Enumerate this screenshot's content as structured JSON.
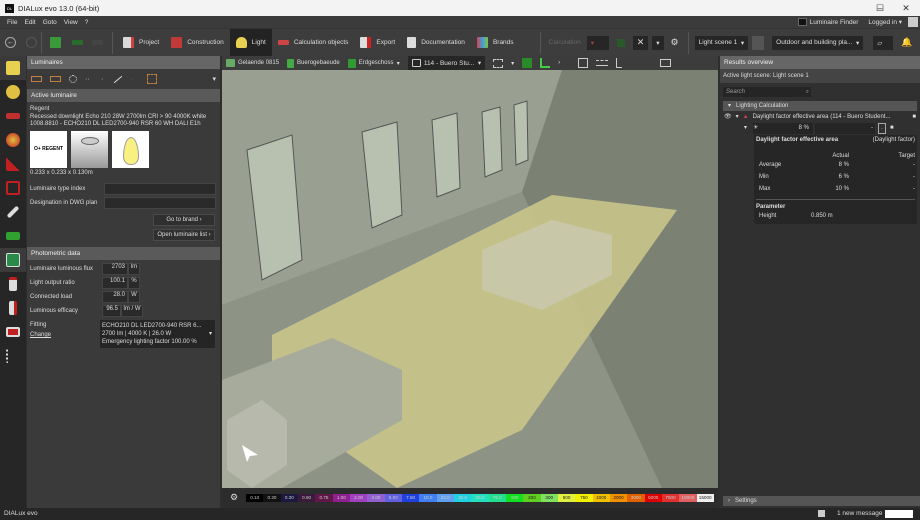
{
  "window": {
    "title": "DIALux evo 13.0  (64-bit)",
    "logo": "DL",
    "minimize": "–",
    "maximize": "☐",
    "close": "✕"
  },
  "menu": [
    "File",
    "Edit",
    "Goto",
    "View",
    "?"
  ],
  "account": {
    "finder": "Luminaire Finder",
    "logged": "Logged in ▾"
  },
  "toolbar": {
    "items": [
      {
        "label": "Project",
        "color": "#d04040"
      },
      {
        "label": "Construction",
        "color": "#c03a3a"
      },
      {
        "label": "Light",
        "color": "#e8d050"
      },
      {
        "label": "Calculation objects",
        "color": "#cc4444"
      },
      {
        "label": "Export",
        "color": "#cc2222"
      },
      {
        "label": "Documentation",
        "color": "#dddddd"
      },
      {
        "label": "Brands",
        "color": "#7fa040"
      }
    ],
    "calculation": "Calculation",
    "light_scene": "Light scene 1",
    "plan": "Outdoor and building pla..."
  },
  "left_panel": {
    "title": "Luminaires",
    "active_title": "Active luminaire",
    "brand": "Regent",
    "desc1": "Recessed downlight Echo 210 28W 2700lm CRI > 90 4000K white",
    "desc2": "1008.8810 - ECHO210 DL LED2700-940 RSR 60 WH DALI E1h",
    "brand_logo": "O+ REGENT",
    "dimensions": "0.233 x 0.233 x 0.130m",
    "type_index_label": "Luminaire type index",
    "dwg_label": "Designation in DWG plan",
    "go_brand": "Go to brand",
    "open_list": "Open luminaire list",
    "photometric_title": "Photometric data",
    "photometric": [
      {
        "label": "Luminaire luminous flux",
        "value": "2703",
        "unit": "lm"
      },
      {
        "label": "Light output ratio",
        "value": "100.1",
        "unit": "%"
      },
      {
        "label": "Connected load",
        "value": "28.0",
        "unit": "W"
      },
      {
        "label": "Luminous efficacy",
        "value": "96.5",
        "unit": "lm / W"
      }
    ],
    "fitting_label": "Fitting",
    "change_label": "Change",
    "fitting": [
      "ECHO210 DL LED2700-940 RSR 6...",
      "2700 lm  |  4000 K  |  26.0 W",
      "Emergency lighting factor 100.00 %"
    ]
  },
  "viewport": {
    "breadcrumbs": [
      "Gelaende 0815",
      "Buerogebaeude",
      "Erdgeschoss",
      "114 - Buero Stu..."
    ],
    "scale": [
      "0.10",
      "0.20",
      "0.30",
      "0.50",
      "0.75",
      "1.00",
      "2.00",
      "3.00",
      "5.00",
      "7.50",
      "10.0",
      "20.0",
      "30.0",
      "50.0",
      "75.0",
      "100",
      "200",
      "300",
      "500",
      "750",
      "1000",
      "2000",
      "3000",
      "5000",
      "7500",
      "10000",
      "15000"
    ],
    "scale_colors": [
      "#000",
      "#111",
      "#1a1a40",
      "#3a1a3a",
      "#601848",
      "#902090",
      "#a040c0",
      "#9060d0",
      "#6060e0",
      "#2040e0",
      "#4080f0",
      "#60a0f0",
      "#20d0e0",
      "#20e0c0",
      "#20e090",
      "#10e020",
      "#60d020",
      "#80e060",
      "#e0f040",
      "#f0f000",
      "#f0c000",
      "#f09000",
      "#e06000",
      "#e00000",
      "#e03030",
      "#e06060",
      "#f0f0f0"
    ]
  },
  "results": {
    "title": "Results overview",
    "active_scene": "Active light scene: Light scene 1",
    "search_placeholder": "Search",
    "section": "Lighting Calculation",
    "object": "Daylight factor effective area (114 - Buero Student...",
    "value": "8 %",
    "card_title": "Daylight factor effective area",
    "card_type": "(Daylight factor)",
    "col_actual": "Actual",
    "col_target": "Target",
    "rows": [
      {
        "label": "Average",
        "actual": "8 %",
        "target": "-"
      },
      {
        "label": "Min",
        "actual": "6 %",
        "target": "-"
      },
      {
        "label": "Max",
        "actual": "10 %",
        "target": "-"
      }
    ],
    "param_title": "Parameter",
    "param_label": "Height",
    "param_value": "0.850 m",
    "settings": "Settings"
  },
  "status": {
    "app": "DIALux evo",
    "message": "1 new message"
  }
}
